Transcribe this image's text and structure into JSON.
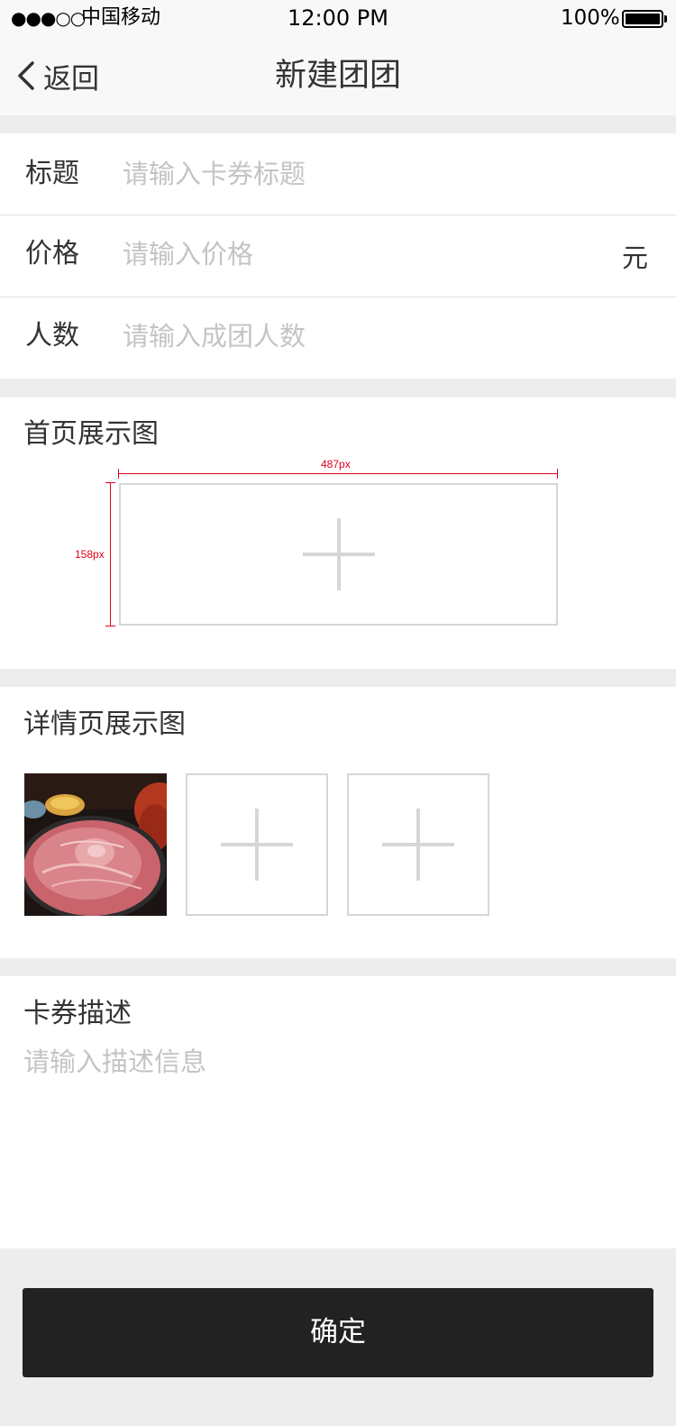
{
  "status_bar": {
    "signal": "●●●○○",
    "carrier": "中国移动",
    "time": "12:00 PM",
    "battery": "100%"
  },
  "nav": {
    "back_label": "返回",
    "title": "新建团团"
  },
  "form": {
    "title_label": "标题",
    "title_placeholder": "请输入卡券标题",
    "price_label": "价格",
    "price_placeholder": "请输入价格",
    "price_unit": "元",
    "people_label": "人数",
    "people_placeholder": "请输入成团人数"
  },
  "home_image": {
    "title": "首页展示图",
    "width_annotation": "487px",
    "height_annotation": "158px"
  },
  "detail_image": {
    "title": "详情页展示图"
  },
  "description": {
    "title": "卡券描述",
    "placeholder": "请输入描述信息"
  },
  "confirm_label": "确定"
}
